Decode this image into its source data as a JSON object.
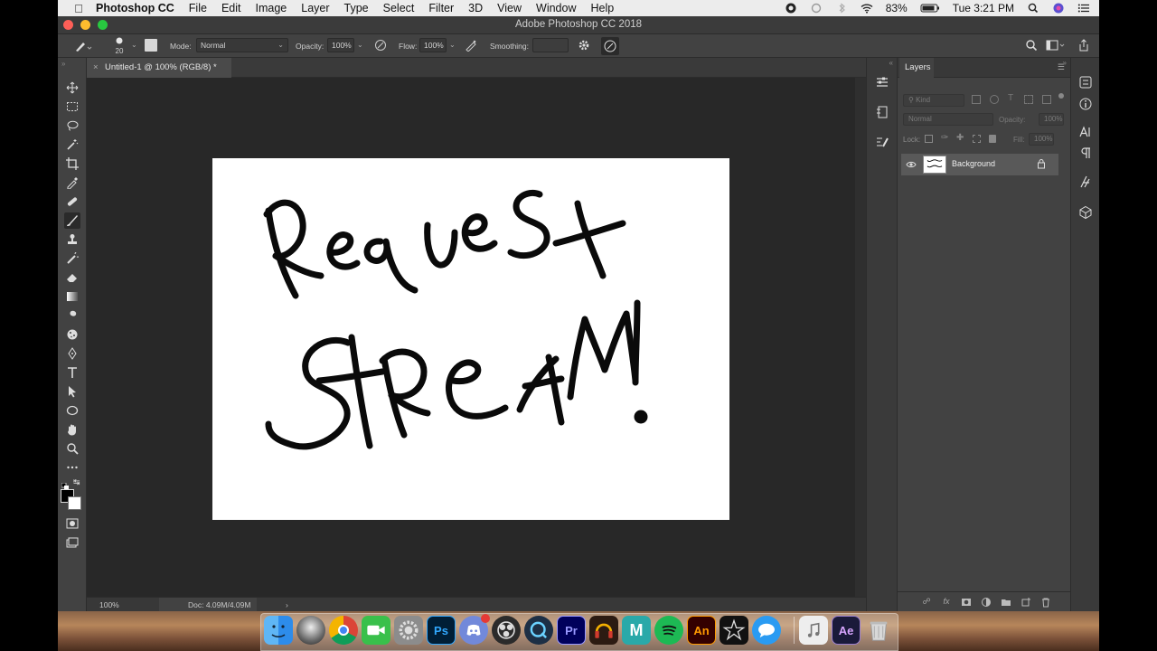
{
  "menubar": {
    "apple_icon": "apple-logo",
    "items": [
      "Photoshop CC",
      "File",
      "Edit",
      "Image",
      "Layer",
      "Type",
      "Select",
      "Filter",
      "3D",
      "View",
      "Window",
      "Help"
    ],
    "battery": "83%",
    "clock": "Tue 3:21 PM"
  },
  "window": {
    "title": "Adobe Photoshop CC 2018"
  },
  "options": {
    "brush_size": "20",
    "mode_label": "Mode:",
    "mode_value": "Normal",
    "opacity_label": "Opacity:",
    "opacity_value": "100%",
    "flow_label": "Flow:",
    "flow_value": "100%",
    "smoothing_label": "Smoothing:",
    "smoothing_value": ""
  },
  "document": {
    "tab_label": "Untitled-1 @ 100% (RGB/8) *",
    "zoom": "100%",
    "doc_size": "Doc: 4.09M/4.09M"
  },
  "layers_panel": {
    "tab": "Layers",
    "kind_placeholder": "Kind",
    "blend_mode": "Normal",
    "opacity_label": "Opacity:",
    "opacity_value": "100%",
    "lock_label": "Lock:",
    "fill_label": "Fill:",
    "fill_value": "100%",
    "layers": [
      {
        "name": "Background",
        "visible": true,
        "locked": true
      }
    ]
  },
  "canvas_text": {
    "line1": "Request",
    "line2": "STREAM!"
  },
  "dock": {
    "apps": [
      "finder",
      "siri",
      "chrome",
      "facetime",
      "system-preferences",
      "photoshop",
      "discord",
      "obs",
      "quicktime",
      "premiere-pro",
      "audition",
      "maya",
      "spotify",
      "animate",
      "zbrush",
      "messages",
      "itunes",
      "after-effects",
      "trash"
    ],
    "labels": {
      "photoshop": "Ps",
      "premiere": "Pr",
      "maya": "M",
      "animate": "An",
      "after_effects": "Ae"
    }
  },
  "colors": {
    "accent": "#2d8ceb",
    "panel": "#424242",
    "workspace": "#282828"
  }
}
